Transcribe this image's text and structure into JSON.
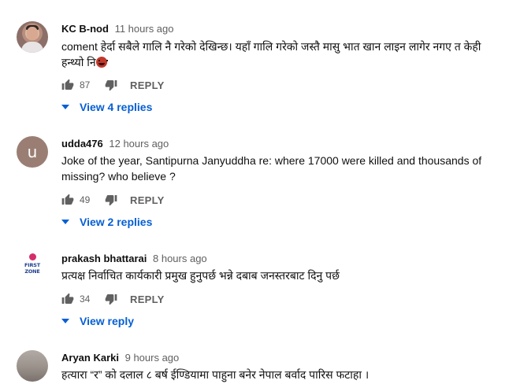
{
  "comments": [
    {
      "author": "KC B-nod",
      "time": "11 hours ago",
      "text_line1": "coment हेर्दा सबैले गालि नै गरेको देखिन्छ। यहाँ गालि गरेको जस्तै मासु भात खान लाइन लागेर नगए त केही",
      "text_line2": "हन्थ्यो नि",
      "likes": "87",
      "reply_label": "REPLY",
      "replies_label": "View 4 replies",
      "avatar": "profile-photo"
    },
    {
      "author": "udda476",
      "time": "12 hours ago",
      "text_line1": "Joke of the year, Santipurna Janyuddha re: where 17000 were killed and thousands of",
      "text_line2": "missing? who believe ?",
      "likes": "49",
      "reply_label": "REPLY",
      "replies_label": "View 2 replies",
      "avatar_letter": "u"
    },
    {
      "author": "prakash bhattarai",
      "time": "8 hours ago",
      "text_line1": "प्रत्यक्ष निर्वाचित कार्यकारी प्रमुख हुनुपर्छ भन्ने दबाब जनस्तरबाट दिनु पर्छ",
      "likes": "34",
      "reply_label": "REPLY",
      "replies_label": "View reply",
      "avatar_text": "FIRST ZONE"
    },
    {
      "author": "Aryan Karki",
      "time": "9 hours ago",
      "text_line1": "हत्यारा “र” को दलाल ८ बर्ष ईण्डियामा पाहुना बनेर नेपाल बर्वाद पारिस फटाहा ।",
      "avatar": "profile-photo"
    }
  ],
  "colors": {
    "link": "#065fd4",
    "muted": "#606060",
    "text": "#0f0f0f"
  },
  "icons": [
    "thumb-up-icon",
    "thumb-down-icon",
    "chevron-down-icon",
    "emoji-face-icon"
  ]
}
